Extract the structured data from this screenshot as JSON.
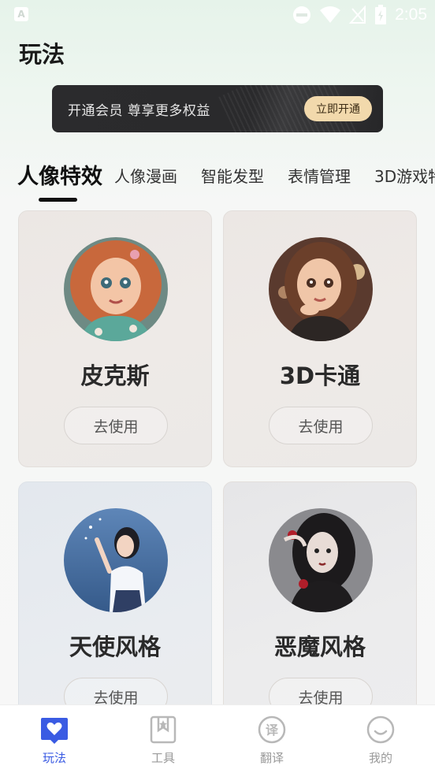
{
  "status_bar": {
    "time": "2:05",
    "app_icon_letter": "A"
  },
  "header": {
    "title": "玩法"
  },
  "vip_banner": {
    "text": "开通会员  尊享更多权益",
    "button_label": "立即开通"
  },
  "tabs": [
    {
      "label": "人像特效",
      "active": true
    },
    {
      "label": "人像漫画",
      "active": false
    },
    {
      "label": "智能发型",
      "active": false
    },
    {
      "label": "表情管理",
      "active": false
    },
    {
      "label": "3D游戏特",
      "active": false
    }
  ],
  "cards": [
    {
      "title": "皮克斯",
      "button_label": "去使用"
    },
    {
      "title": "3D卡通",
      "button_label": "去使用"
    },
    {
      "title": "天使风格",
      "button_label": "去使用"
    },
    {
      "title": "恶魔风格",
      "button_label": "去使用"
    }
  ],
  "bottom_nav": [
    {
      "label": "玩法",
      "icon": "heart-chat-icon",
      "active": true
    },
    {
      "label": "工具",
      "icon": "bookmark-star-icon",
      "active": false
    },
    {
      "label": "翻译",
      "icon": "translate-icon",
      "active": false
    },
    {
      "label": "我的",
      "icon": "smile-icon",
      "active": false
    }
  ],
  "colors": {
    "accent": "#3a5be3",
    "vip_button": "#f2d9ac",
    "vip_banner": "#2b2b2d"
  }
}
